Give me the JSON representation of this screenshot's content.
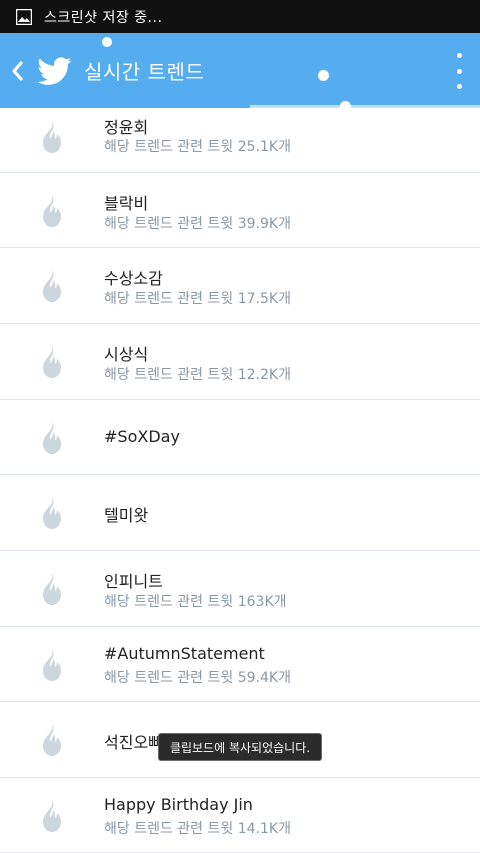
{
  "status_bar": {
    "text": "스크린샷 저장 중..."
  },
  "app_bar": {
    "title": "실시간 트렌드"
  },
  "trends": [
    {
      "name": "정윤회",
      "subtitle": "해당 트렌드 관련 트윗 25.1K개"
    },
    {
      "name": "블락비",
      "subtitle": "해당 트렌드 관련 트윗 39.9K개"
    },
    {
      "name": "수상소감",
      "subtitle": "해당 트렌드 관련 트윗 17.5K개"
    },
    {
      "name": "시상식",
      "subtitle": "해당 트렌드 관련 트윗 12.2K개"
    },
    {
      "name": "#SoXDay",
      "subtitle": ""
    },
    {
      "name": "텔미왓",
      "subtitle": ""
    },
    {
      "name": "인피니트",
      "subtitle": "해당 트렌드 관련 트윗 163K개"
    },
    {
      "name": "#AutumnStatement",
      "subtitle": "해당 트렌드 관련 트윗 59.4K개"
    },
    {
      "name": "석진오빠",
      "subtitle": ""
    },
    {
      "name": "Happy Birthday Jin",
      "subtitle": "해당 트렌드 관련 트윗 14.1K개"
    }
  ],
  "toast": {
    "text": "클립보드에 복사되었습니다."
  },
  "colors": {
    "accent": "#55acee",
    "status_bar": "#111111",
    "flame": "#ccd6dd",
    "subtitle": "#8899a6"
  },
  "icons": {
    "status": "picture-icon",
    "back": "chevron-left-icon",
    "logo": "twitter-bird-icon",
    "menu": "overflow-menu-icon",
    "trend": "flame-icon"
  }
}
